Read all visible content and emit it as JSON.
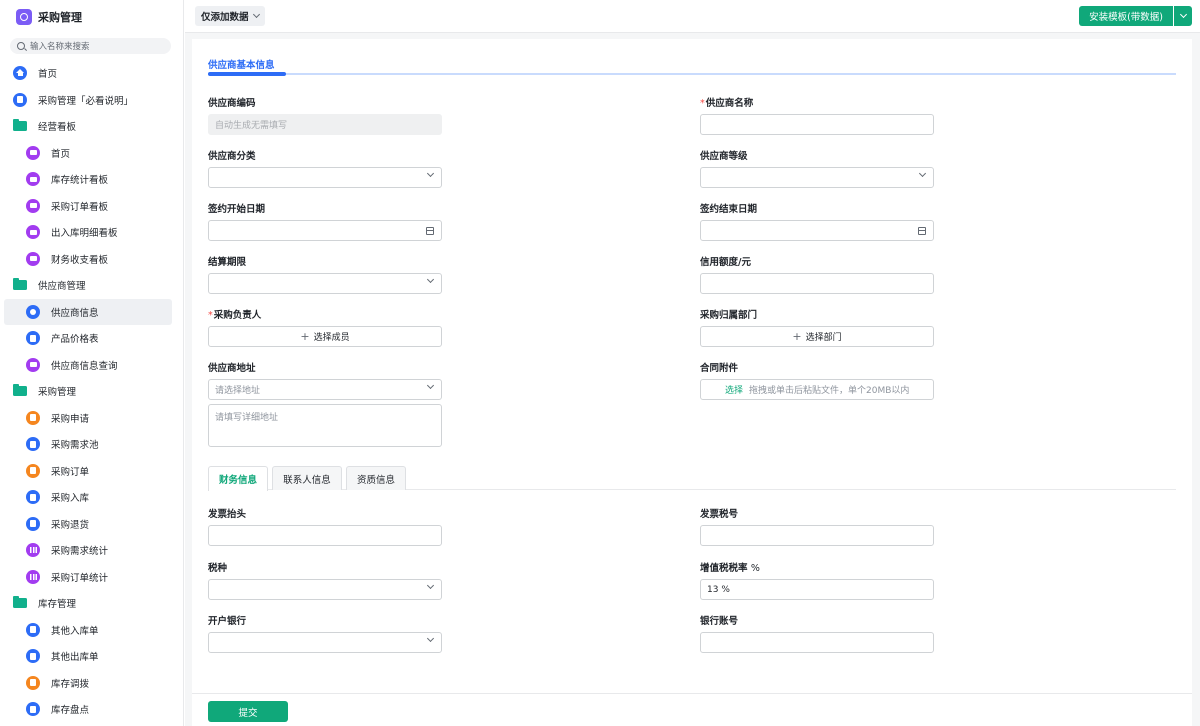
{
  "app": {
    "title": "采购管理"
  },
  "search": {
    "placeholder": "输入名称来搜索"
  },
  "sidebar": {
    "items": [
      {
        "label": "首页"
      },
      {
        "label": "采购管理「必看说明」"
      },
      {
        "label": "经营看板"
      },
      {
        "label": "首页"
      },
      {
        "label": "库存统计看板"
      },
      {
        "label": "采购订单看板"
      },
      {
        "label": "出入库明细看板"
      },
      {
        "label": "财务收支看板"
      },
      {
        "label": "供应商管理"
      },
      {
        "label": "供应商信息"
      },
      {
        "label": "产品价格表"
      },
      {
        "label": "供应商信息查询"
      },
      {
        "label": "采购管理"
      },
      {
        "label": "采购申请"
      },
      {
        "label": "采购需求池"
      },
      {
        "label": "采购订单"
      },
      {
        "label": "采购入库"
      },
      {
        "label": "采购退货"
      },
      {
        "label": "采购需求统计"
      },
      {
        "label": "采购订单统计"
      },
      {
        "label": "库存管理"
      },
      {
        "label": "其他入库单"
      },
      {
        "label": "其他出库单"
      },
      {
        "label": "库存调拨"
      },
      {
        "label": "库存盘点"
      }
    ]
  },
  "topbar": {
    "filter_label": "仅添加数据",
    "install_label": "安装模板(带数据)"
  },
  "form": {
    "section_title": "供应商基本信息",
    "supplier_code": {
      "label": "供应商编码",
      "placeholder": "自动生成无需填写"
    },
    "supplier_name": {
      "label": "供应商名称"
    },
    "supplier_category": {
      "label": "供应商分类"
    },
    "supplier_level": {
      "label": "供应商等级"
    },
    "contract_start": {
      "label": "签约开始日期"
    },
    "contract_end": {
      "label": "签约结束日期"
    },
    "settlement_period": {
      "label": "结算期限"
    },
    "credit_limit": {
      "label": "信用额度/元"
    },
    "purchase_owner": {
      "label": "采购负责人",
      "button": "选择成员"
    },
    "purchase_department": {
      "label": "采购归属部门",
      "button": "选择部门"
    },
    "supplier_address": {
      "label": "供应商地址",
      "select_placeholder": "请选择地址",
      "detail_placeholder": "请填写详细地址"
    },
    "contract_attachment": {
      "label": "合同附件",
      "choose": "选择",
      "hint": "拖拽或单击后粘贴文件，单个20MB以内"
    }
  },
  "tabs": [
    {
      "label": "财务信息"
    },
    {
      "label": "联系人信息"
    },
    {
      "label": "资质信息"
    }
  ],
  "finance": {
    "invoice_title": {
      "label": "发票抬头"
    },
    "invoice_tax_no": {
      "label": "发票税号"
    },
    "tax_type": {
      "label": "税种"
    },
    "vat_rate": {
      "label": "增值税税率",
      "unit": "%",
      "value": "13 %"
    },
    "bank": {
      "label": "开户银行"
    },
    "bank_account": {
      "label": "银行账号"
    }
  },
  "footer": {
    "submit_label": "提交"
  },
  "colors": {
    "primary": "#10a87a",
    "accent_blue": "#2d6cf6",
    "required": "#f54a45"
  }
}
